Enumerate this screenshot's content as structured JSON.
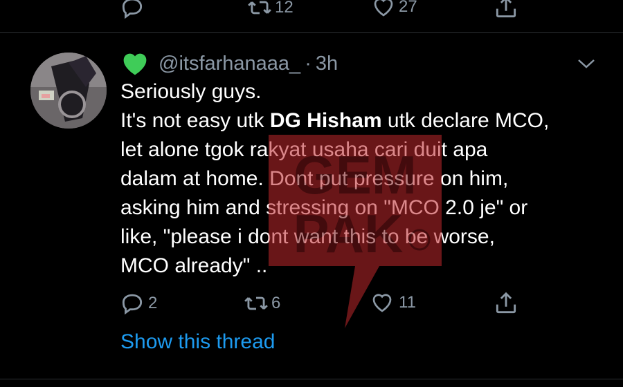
{
  "previous_tweet": {
    "actions": {
      "retweets": "12",
      "likes": "27"
    }
  },
  "tweet": {
    "author_emoji": "green-heart-icon",
    "handle": "@itsfarhanaaa_",
    "separator": "·",
    "time": "3h",
    "text": {
      "line1": "Seriously guys.",
      "line2_pre": "It's not easy utk ",
      "line2_bold": "DG Hisham",
      "line2_post": " utk declare MCO,",
      "rest": "let alone tgok rakyat usaha cari duit apa\ndalam at home. Dont put pressure on him,\nasking him and stressing on \"MCO 2.0 je\" or\nlike, \"please i dont want this to be worse,\nMCO already\" .."
    },
    "actions": {
      "replies": "2",
      "retweets": "6",
      "likes": "11"
    },
    "show_thread": "Show this thread"
  },
  "watermark": {
    "line1": "GEM",
    "line2": "PAK"
  },
  "colors": {
    "background": "#000000",
    "text": "#ffffff",
    "muted": "#8b98a5",
    "link": "#1d9bf0",
    "divider": "#2f3336",
    "watermark": "#c0282d"
  }
}
